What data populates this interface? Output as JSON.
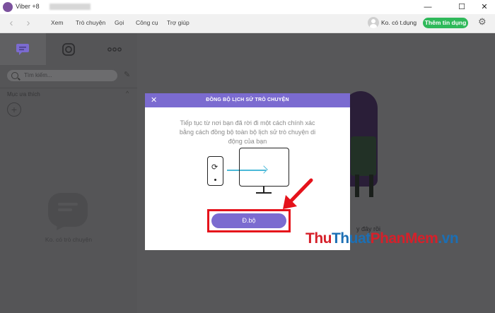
{
  "window": {
    "title": "Viber +8",
    "controls": {
      "minimize": "—",
      "maximize": "☐",
      "close": "✕"
    }
  },
  "navbar": {
    "back": "‹",
    "forward": "›",
    "menu": [
      "Xem",
      "Trò chuyện",
      "Gọi",
      "Công cụ",
      "Trợ giúp"
    ],
    "user_name": "Ko. có t.dụng",
    "add_contact_label": "Thêm tin dụng",
    "settings_glyph": "⚙"
  },
  "sidebar": {
    "search_placeholder": "Tìm kiếm...",
    "favorites_label": "Mục ưa thích",
    "favorites_chevron": "^",
    "add_glyph": "+",
    "empty_text": "Ko. có trò chuyện"
  },
  "main": {
    "partial_text": "y đây rồi"
  },
  "dialog": {
    "close_glyph": "✕",
    "title": "ĐỒNG BỘ LỊCH SỬ TRÒ CHUYỆN",
    "body": "Tiếp tục từ nơi bạn đã rời đi một cách chính xác bằng cách đồng bộ toàn bộ lịch sử trò chuyện di động của bạn",
    "sync_glyph": "⟳",
    "sync_button": "Đ.bộ"
  },
  "watermark": {
    "part1": "Thu",
    "part2": "Thuat",
    "part3": "PhanMem",
    "part4": ".vn"
  },
  "colors": {
    "accent": "#7b6bd0",
    "viber": "#7b519d",
    "green": "#2fb95a",
    "highlight": "#e5121b",
    "watermark_red": "#d6202a",
    "watermark_blue": "#1c6fb4"
  }
}
